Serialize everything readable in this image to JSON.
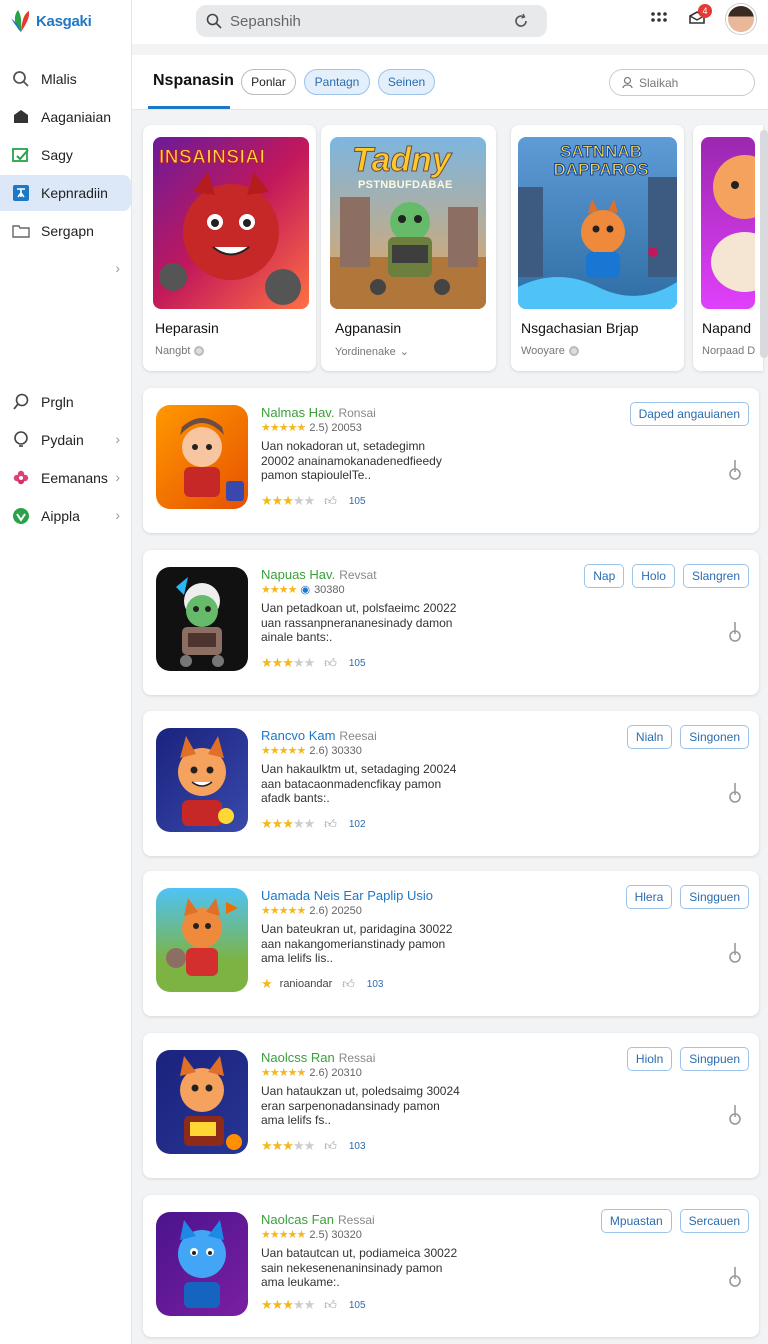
{
  "app": {
    "name": "Kasgaki"
  },
  "search": {
    "placeholder": "Sepanshih"
  },
  "topbar": {
    "notif_count": "4"
  },
  "sidebar": {
    "items": [
      {
        "label": "Mlalis",
        "icon": "search-icon"
      },
      {
        "label": "Aaganiaian",
        "icon": "inbox-icon"
      },
      {
        "label": "Sagy",
        "icon": "edit-icon"
      },
      {
        "label": "Kepnradiin",
        "icon": "pin-icon",
        "active": true
      },
      {
        "label": "Sergapn",
        "icon": "folder-icon"
      }
    ],
    "items2": [
      {
        "label": "Prgln",
        "icon": "search-icon"
      },
      {
        "label": "Pydain",
        "icon": "bulb-icon"
      },
      {
        "label": "Eemanans",
        "icon": "flower-icon"
      },
      {
        "label": "Aippla",
        "icon": "check-circle-icon"
      }
    ]
  },
  "tabs": {
    "main": "Nspanasin",
    "pills": [
      "Ponlar",
      "Pantagn",
      "Seinen"
    ],
    "search_placeholder": "Slaikah"
  },
  "featured": [
    {
      "art_title": "INSAINSIAI",
      "title": "Heparasin",
      "sub": "Nangbt"
    },
    {
      "art_title": "Tadny",
      "art_sub": "PSTNBUFDABAE",
      "title": "Agpanasin",
      "sub": "Yordinenake"
    },
    {
      "art_title": "SATNNAB DAPPAROS",
      "title": "Nsgachasian Brjap",
      "sub": "Wooyare"
    },
    {
      "title": "Napand",
      "sub": "Norpaad D"
    }
  ],
  "rows": [
    {
      "name": "Nalmas Hav.",
      "tag": "Ronsai",
      "meta": "2.5) 20053",
      "desc": "Uan nokadoran ut, setadegimn 20002 anainamokanadenedfieedy pamon stapioulelTe..",
      "rating": 3,
      "rating_text": "",
      "count": "105",
      "buttons": [
        "Daped angauianen"
      ],
      "name_color": "green"
    },
    {
      "name": "Napuas Hav.",
      "tag": "Revsat",
      "meta": "30380",
      "desc": "Uan petadkoan ut, polsfaeimc 20022 uan rassanpnerananesinady damon ainale bants:.",
      "rating": 3,
      "rating_text": "",
      "count": "105",
      "buttons": [
        "Nap",
        "Holo",
        "Slangren"
      ],
      "name_color": "green"
    },
    {
      "name": "Rancvo Kam",
      "tag": "Reesai",
      "meta": "2.6) 30330",
      "desc": "Uan hakaulktm ut, setadaging 20024 aan batacaonmadencfikay pamon afadk bants:.",
      "rating": 3,
      "rating_text": "",
      "count": "102",
      "buttons": [
        "Nialn",
        "Singonen"
      ],
      "name_color": "blue"
    },
    {
      "name": "Uamada Neis Ear Paplip Usio",
      "tag": "",
      "meta": "2.6) 20250",
      "desc": "Uan bateukran ut, paridagina 30022 aan nakangomerianstinady pamon ama lelifs lis..",
      "rating": 1,
      "rating_text": "ranioandar",
      "count": "103",
      "buttons": [
        "Hlera",
        "Singguen"
      ],
      "name_color": "blue"
    },
    {
      "name": "Naolcss Ran",
      "tag": "Ressai",
      "meta": "2.6) 20310",
      "desc": "Uan hataukzan ut, poledsaimg 30024 eran sarpenonadansinady pamon ama lelifs fs..",
      "rating": 3,
      "rating_text": "",
      "count": "103",
      "buttons": [
        "Hioln",
        "Singpuen"
      ],
      "name_color": "green"
    },
    {
      "name": "Naolcas Fan",
      "tag": "Ressai",
      "meta": "2.5) 30320",
      "desc": "Uan batautcan ut, podiameica 30022 sain nekesenenaninsinady pamon ama leukame:.",
      "rating": 3,
      "rating_text": "",
      "count": "105",
      "buttons": [
        "Mpuastan",
        "Sercauen"
      ],
      "name_color": "green"
    }
  ],
  "colors": {
    "accent": "#1e78c8",
    "green": "#3aa03a",
    "star": "#f3b81d"
  }
}
